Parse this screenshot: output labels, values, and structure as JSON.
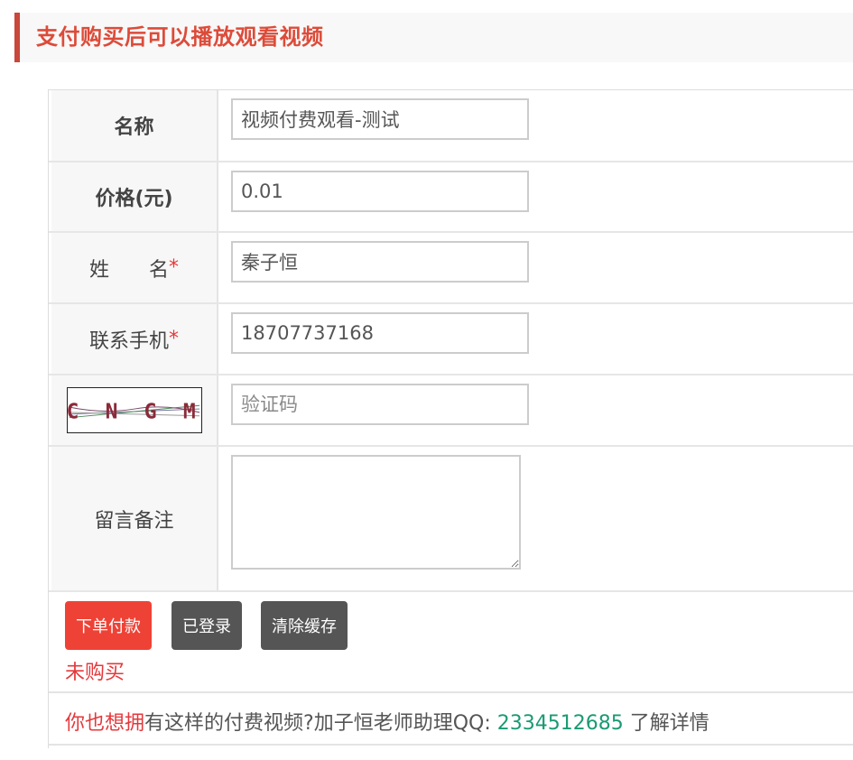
{
  "header": {
    "title": "支付购买后可以播放观看视频",
    "title_color": "#dd4b39",
    "accent_color": "#c9473b"
  },
  "form": {
    "name": {
      "label": "名称",
      "value": "视频付费观看-测试"
    },
    "price": {
      "label": "价格(元)",
      "value": "0.01"
    },
    "fullname": {
      "label": "姓　　名",
      "required_mark": "*",
      "value": "秦子恒"
    },
    "phone": {
      "label": "联系手机",
      "required_mark": "*",
      "value": "18707737168"
    },
    "captcha": {
      "image_text": "C N G M",
      "placeholder": "验证码",
      "value": ""
    },
    "remark": {
      "label": "留言备注",
      "value": ""
    }
  },
  "actions": {
    "pay_label": "下单付款",
    "login_label": "已登录",
    "clear_label": "清除缓存",
    "pay_color": "#ee4236",
    "neutral_color": "#555555"
  },
  "status": {
    "text": "未购买"
  },
  "footer": {
    "highlight": "你也想拥",
    "text": "有这样的付费视频?加子恒老师助理QQ: ",
    "qq": "2334512685",
    "suffix": " 了解详情"
  }
}
